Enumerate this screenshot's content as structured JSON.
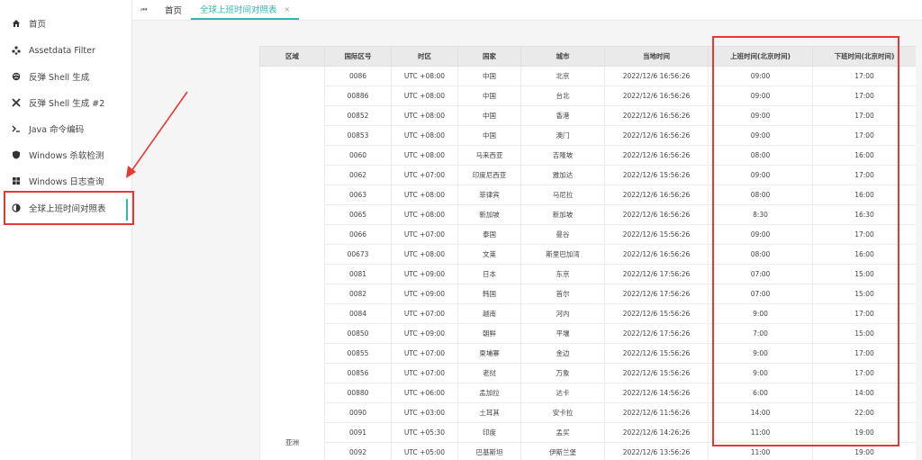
{
  "sidebar": {
    "items": [
      {
        "label": "首页",
        "icon": "home-icon"
      },
      {
        "label": "Assetdata Filter",
        "icon": "nodes-icon"
      },
      {
        "label": "反弹 Shell 生成",
        "icon": "globe-icon"
      },
      {
        "label": "反弹 Shell 生成 #2",
        "icon": "tools-icon"
      },
      {
        "label": "Java 命令编码",
        "icon": "terminal-icon"
      },
      {
        "label": "Windows 杀软检测",
        "icon": "shield-icon"
      },
      {
        "label": "Windows 日志查询",
        "icon": "windows-icon"
      },
      {
        "label": "全球上班时间对照表",
        "icon": "halfcircle-icon"
      }
    ],
    "active_index": 7
  },
  "topbar": {
    "tabs": [
      {
        "label": "首页"
      },
      {
        "label": "全球上班时间对照表",
        "close": "×"
      }
    ]
  },
  "table": {
    "headers": [
      "区域",
      "国际区号",
      "时区",
      "国家",
      "城市",
      "当地时间",
      "上班时间(北京时间)",
      "下班时间(北京时间)"
    ],
    "region": "亚洲",
    "rows": [
      {
        "code": "0086",
        "tz": "UTC +08:00",
        "country": "中国",
        "city": "北京",
        "local": "2022/12/6 16:56:26",
        "start": "09:00",
        "end": "17:00"
      },
      {
        "code": "00886",
        "tz": "UTC +08:00",
        "country": "中国",
        "city": "台北",
        "local": "2022/12/6 16:56:26",
        "start": "09:00",
        "end": "17:00"
      },
      {
        "code": "00852",
        "tz": "UTC +08:00",
        "country": "中国",
        "city": "香港",
        "local": "2022/12/6 16:56:26",
        "start": "09:00",
        "end": "17:00"
      },
      {
        "code": "00853",
        "tz": "UTC +08:00",
        "country": "中国",
        "city": "澳门",
        "local": "2022/12/6 16:56:26",
        "start": "09:00",
        "end": "17:00"
      },
      {
        "code": "0060",
        "tz": "UTC +08:00",
        "country": "马来西亚",
        "city": "吉隆坡",
        "local": "2022/12/6 16:56:26",
        "start": "08:00",
        "end": "16:00"
      },
      {
        "code": "0062",
        "tz": "UTC +07:00",
        "country": "印度尼西亚",
        "city": "雅加达",
        "local": "2022/12/6 15:56:26",
        "start": "09:00",
        "end": "17:00"
      },
      {
        "code": "0063",
        "tz": "UTC +08:00",
        "country": "菲律宾",
        "city": "马尼拉",
        "local": "2022/12/6 16:56:26",
        "start": "08:00",
        "end": "16:00"
      },
      {
        "code": "0065",
        "tz": "UTC +08:00",
        "country": "新加坡",
        "city": "新加坡",
        "local": "2022/12/6 16:56:26",
        "start": "8:30",
        "end": "16:30"
      },
      {
        "code": "0066",
        "tz": "UTC +07:00",
        "country": "泰国",
        "city": "曼谷",
        "local": "2022/12/6 15:56:26",
        "start": "09:00",
        "end": "17:00"
      },
      {
        "code": "00673",
        "tz": "UTC +08:00",
        "country": "文莱",
        "city": "斯里巴加湾",
        "local": "2022/12/6 16:56:26",
        "start": "08:00",
        "end": "16:00"
      },
      {
        "code": "0081",
        "tz": "UTC +09:00",
        "country": "日本",
        "city": "东京",
        "local": "2022/12/6 17:56:26",
        "start": "07:00",
        "end": "15:00"
      },
      {
        "code": "0082",
        "tz": "UTC +09:00",
        "country": "韩国",
        "city": "首尔",
        "local": "2022/12/6 17:56:26",
        "start": "07:00",
        "end": "15:00"
      },
      {
        "code": "0084",
        "tz": "UTC +07:00",
        "country": "越南",
        "city": "河内",
        "local": "2022/12/6 15:56:26",
        "start": "9:00",
        "end": "17:00"
      },
      {
        "code": "00850",
        "tz": "UTC +09:00",
        "country": "朝鲜",
        "city": "平壤",
        "local": "2022/12/6 17:56:26",
        "start": "7:00",
        "end": "15:00"
      },
      {
        "code": "00855",
        "tz": "UTC +07:00",
        "country": "柬埔寨",
        "city": "金边",
        "local": "2022/12/6 15:56:26",
        "start": "9:00",
        "end": "17:00"
      },
      {
        "code": "00856",
        "tz": "UTC +07:00",
        "country": "老挝",
        "city": "万象",
        "local": "2022/12/6 15:56:26",
        "start": "9:00",
        "end": "17:00"
      },
      {
        "code": "00880",
        "tz": "UTC +06:00",
        "country": "孟加拉",
        "city": "达卡",
        "local": "2022/12/6 14:56:26",
        "start": "6:00",
        "end": "14:00"
      },
      {
        "code": "0090",
        "tz": "UTC +03:00",
        "country": "土耳其",
        "city": "安卡拉",
        "local": "2022/12/6 11:56:26",
        "start": "14:00",
        "end": "22:00"
      },
      {
        "code": "0091",
        "tz": "UTC +05:30",
        "country": "印度",
        "city": "孟买",
        "local": "2022/12/6 14:26:26",
        "start": "11:00",
        "end": "19:00"
      },
      {
        "code": "0092",
        "tz": "UTC +05:00",
        "country": "巴基斯坦",
        "city": "伊斯兰堡",
        "local": "2022/12/6 13:56:26",
        "start": "11:00",
        "end": "19:00"
      }
    ]
  },
  "colors": {
    "accent": "#36b6b0",
    "highlight": "#e53935",
    "header_bg": "#eaeaea"
  }
}
